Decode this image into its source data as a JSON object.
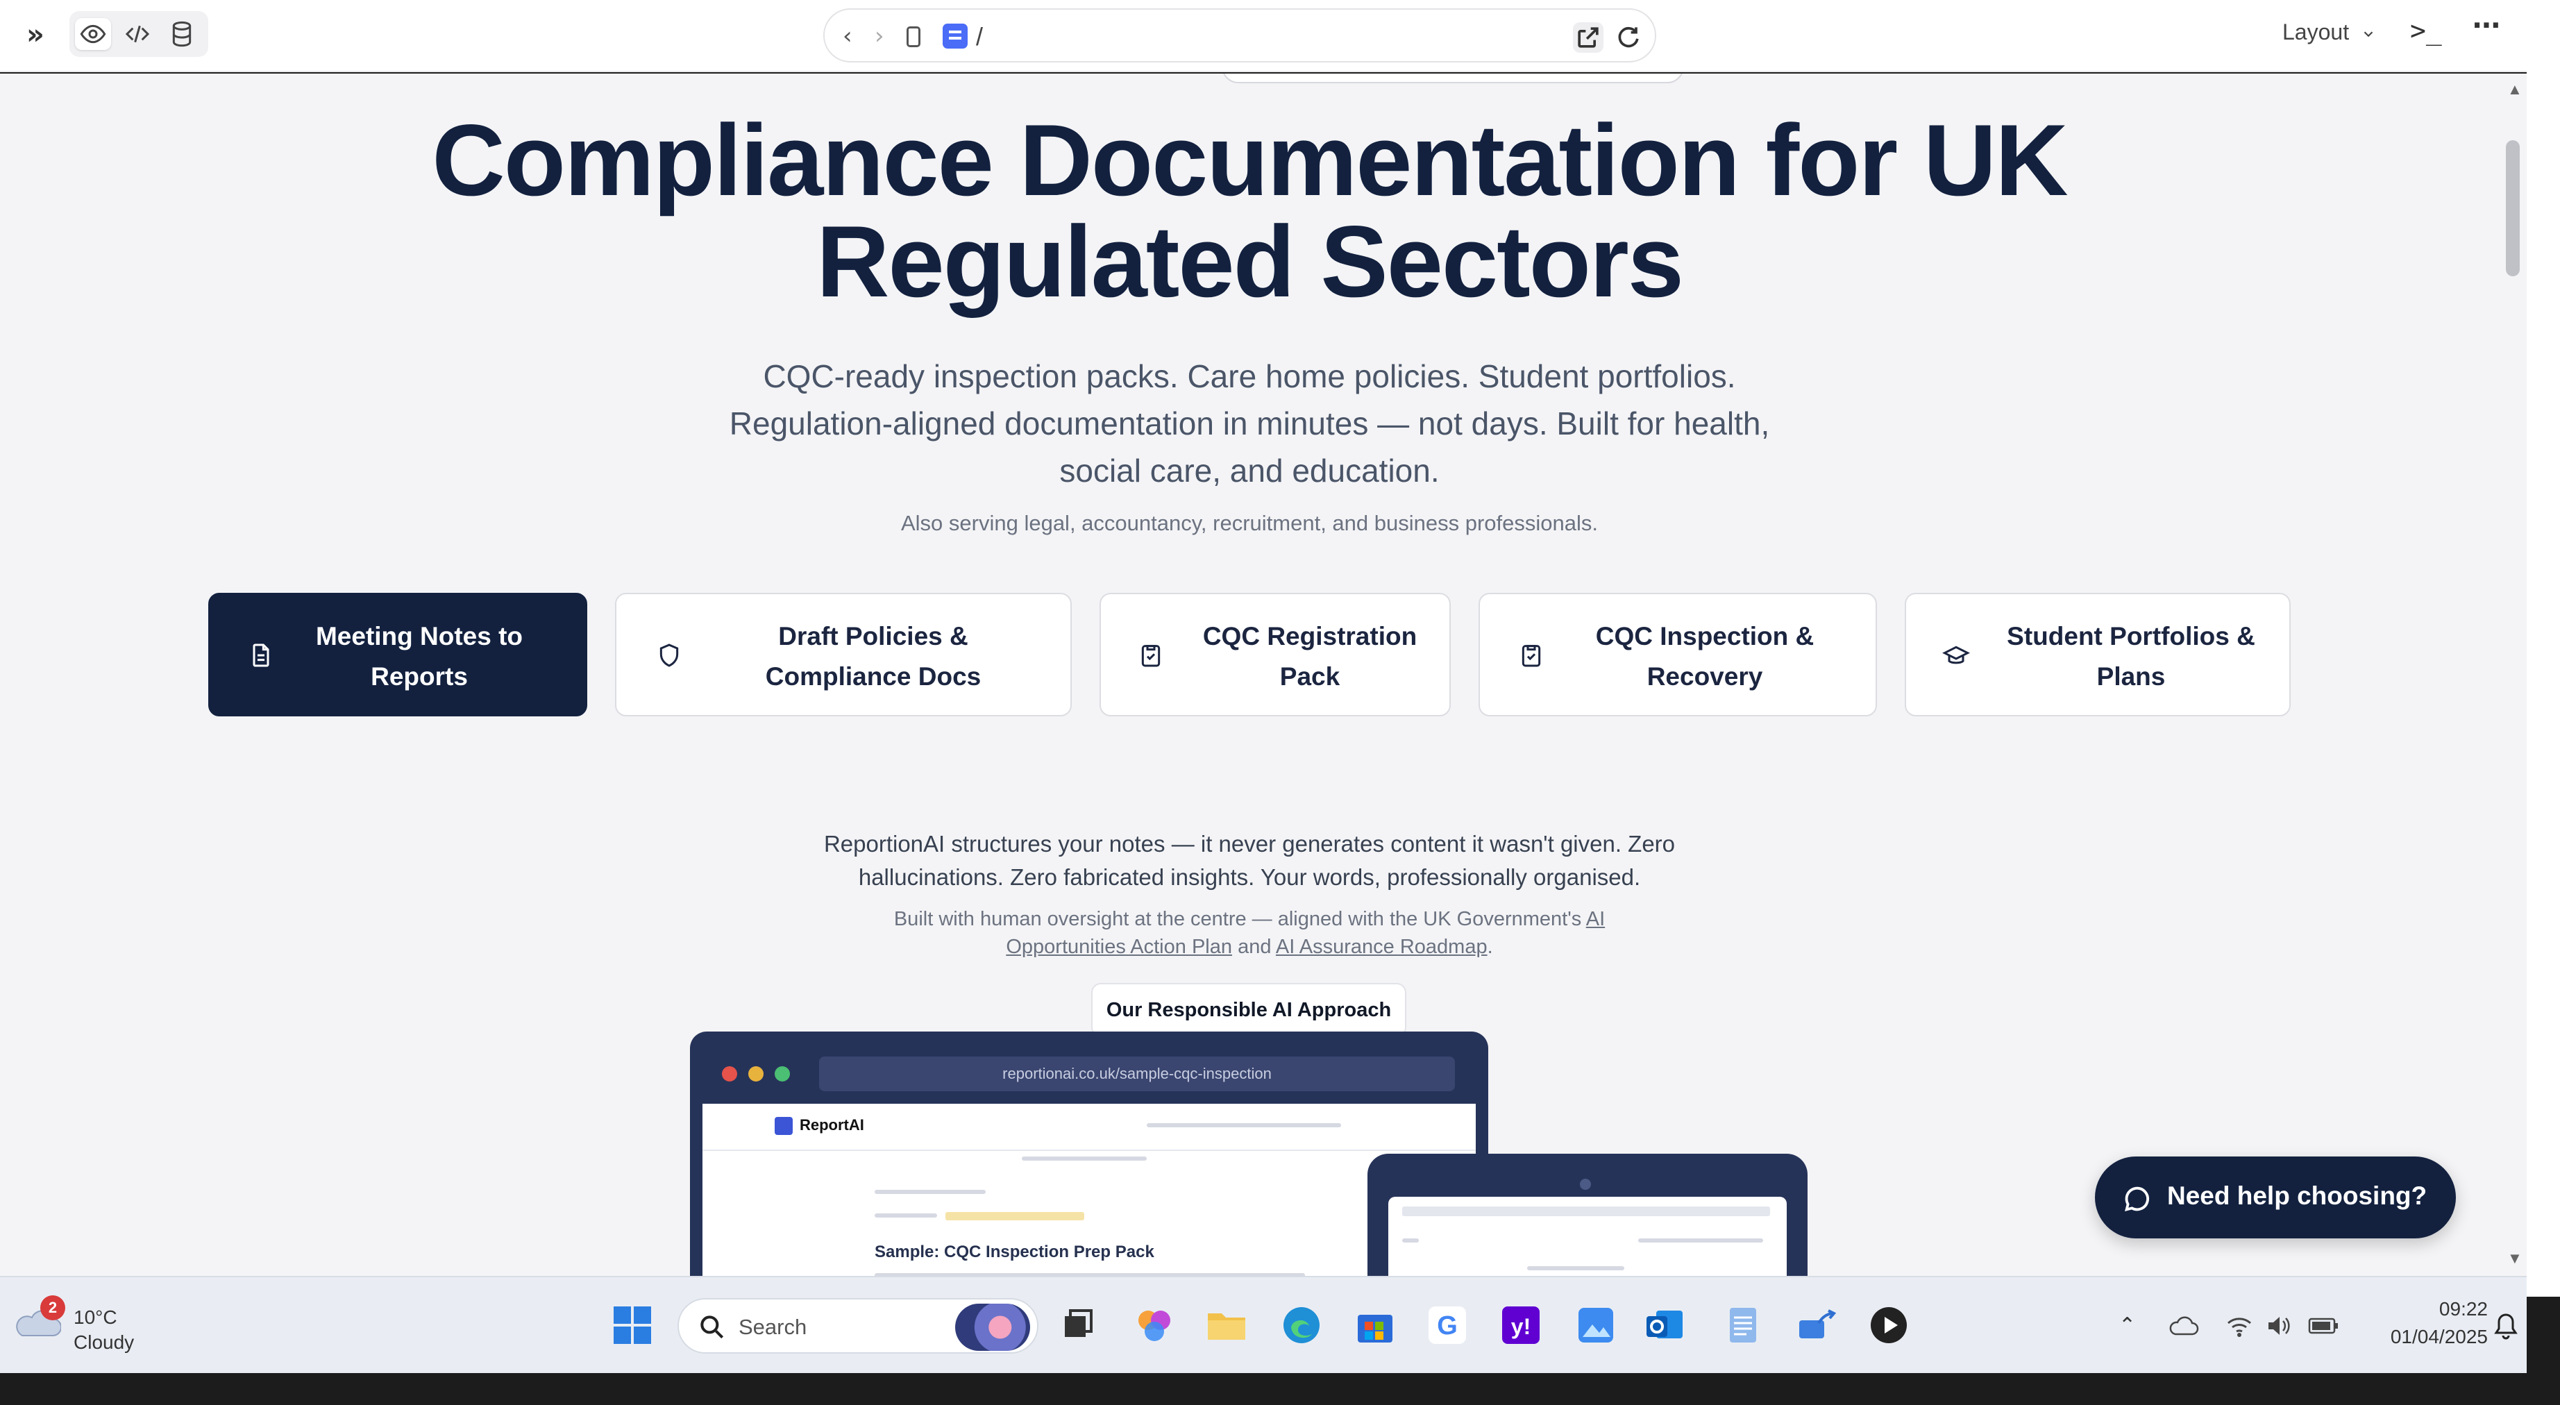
{
  "browser": {
    "url_path": "/",
    "layout_label": "Layout",
    "terminal_glyph": ">_",
    "more_glyph": "⋯",
    "expand_glyph": "»"
  },
  "hero": {
    "title_line1": "Compliance Documentation for UK",
    "title_line2": "Regulated Sectors",
    "subtitle_line1": "CQC-ready inspection packs. Care home policies. Student portfolios.",
    "subtitle_line2": "Regulation-aligned documentation in minutes — not days. Built for health,",
    "subtitle_line3": "social care, and education.",
    "also_serving": "Also serving legal, accountancy, recruitment, and business professionals."
  },
  "tabs": [
    {
      "line1": "Meeting Notes to",
      "line2": "Reports",
      "icon": "document-icon",
      "active": true
    },
    {
      "line1": "Draft Policies &",
      "line2": "Compliance Docs",
      "icon": "shield-icon",
      "active": false
    },
    {
      "line1": "CQC Registration",
      "line2": "Pack",
      "icon": "clipboard-check-icon",
      "active": false
    },
    {
      "line1": "CQC Inspection &",
      "line2": "Recovery",
      "icon": "clipboard-check-icon",
      "active": false
    },
    {
      "line1": "Student Portfolios &",
      "line2": "Plans",
      "icon": "graduation-cap-icon",
      "active": false
    }
  ],
  "body": {
    "note_line1": "ReportionAI structures your notes — it never generates content it wasn't given. Zero",
    "note_line2": "hallucinations. Zero fabricated insights. Your words, professionally organised.",
    "small_line1_prefix": "Built with human oversight at the centre — aligned with the UK Government's",
    "small_link1a": "AI",
    "small_link1b": "Opportunities Action Plan",
    "small_and": "and",
    "small_link2": "AI Assurance Roadmap",
    "small_period": ".",
    "ai_button": "Our Responsible AI Approach"
  },
  "mockup": {
    "laptop_url": "reportionai.co.uk/sample-cqc-inspection",
    "laptop_brand": "ReportAI",
    "laptop_heading": "Sample: CQC Inspection Prep Pack"
  },
  "help_button": "Need help choosing?",
  "taskbar": {
    "weather_temp": "10°C",
    "weather_cond": "Cloudy",
    "weather_badge": "2",
    "search_placeholder": "Search",
    "time": "09:22",
    "date": "01/04/2025"
  },
  "colors": {
    "navy": "#13213f",
    "page_bg": "#f4f4f6",
    "accent_blue": "#4a6cf7"
  }
}
